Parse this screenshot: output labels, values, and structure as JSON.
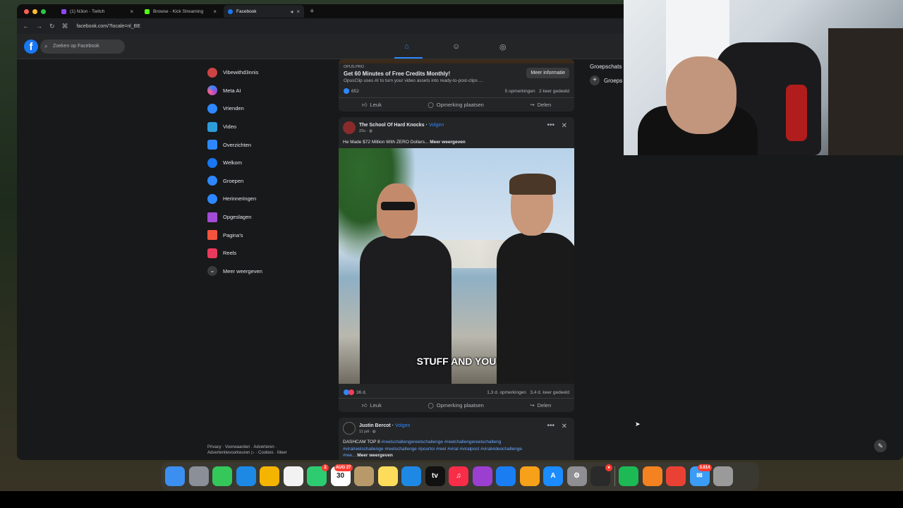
{
  "browser": {
    "tabs": [
      {
        "label": "(1) N3on - Twitch",
        "color": "#9146ff"
      },
      {
        "label": "Browse - Kick Streaming",
        "color": "#53fc18"
      },
      {
        "label": "Facebook",
        "color": "#1877f2"
      }
    ],
    "url": "facebook.com/?locale=nl_BE"
  },
  "facebook": {
    "logo": "f",
    "search_placeholder": "Zoeken op Facebook",
    "sidebar": [
      {
        "label": "Vibewithd3nnis",
        "icon": "avatar",
        "color": "#c44"
      },
      {
        "label": "Meta AI",
        "icon": "meta-ai-icon",
        "color": "#6a5cff"
      },
      {
        "label": "Vrienden",
        "icon": "friends-icon",
        "color": "#2d88ff"
      },
      {
        "label": "Video",
        "icon": "video-icon",
        "color": "#2d9cdb"
      },
      {
        "label": "Overzichten",
        "icon": "feeds-icon",
        "color": "#2d88ff"
      },
      {
        "label": "Welkom",
        "icon": "facebook-icon",
        "color": "#1877f2"
      },
      {
        "label": "Groepen",
        "icon": "groups-icon",
        "color": "#2d88ff"
      },
      {
        "label": "Herinneringen",
        "icon": "memories-icon",
        "color": "#2d88ff"
      },
      {
        "label": "Opgeslagen",
        "icon": "saved-icon",
        "color": "#a34bd6"
      },
      {
        "label": "Pagina's",
        "icon": "pages-icon",
        "color": "#f5533d"
      },
      {
        "label": "Reels",
        "icon": "reels-icon",
        "color": "#e83a5c"
      },
      {
        "label": "Meer weergeven",
        "icon": "chevron-down-icon",
        "color": "#3a3b3c"
      }
    ],
    "footer_line1": "Privacy · Voorwaarden · Adverteren ·",
    "footer_line2": "Advertentievoorkeuren ▷ · Cookies · Meer",
    "ad": {
      "source": "OPUS.PRO",
      "title": "Get 60 Minutes of Free Credits Monthly!",
      "subtitle": "OpusClip uses AI to turn your video assets into ready-to-post-clips ...",
      "button": "Meer informatie",
      "reactions": "652",
      "comments": "5 opmerkingen",
      "shares": "2 keer gedeeld"
    },
    "actions": {
      "like": "Leuk",
      "comment": "Opmerking plaatsen",
      "share": "Delen"
    },
    "post1": {
      "author": "The School Of Hard Knocks",
      "follow": "Volgen",
      "time": "22u · ◍",
      "text": "He Made $72 Million With ZERO Dollars...",
      "more": "Meer weergeven",
      "caption": "STUFF AND YOU",
      "reactions": "36 d.",
      "comments": "1,3 d. opmerkingen",
      "shares": "3,4 d. keer gedeeld"
    },
    "post2": {
      "author": "Justin Bercot",
      "follow": "Volgen",
      "time": "11 juli · ◍",
      "line1_plain": "DASHCAM TOP 8 ",
      "line1_tags": "#reelschallengereelschallenge #reelchallengereelschalleng",
      "line2_tags": "#viralreelschallenge #reelschallenge #pourtoi #reel #viral #viralpost #viralvideochallenge",
      "line3_tags": "#ree...",
      "more": "Meer weergeven"
    },
    "right_heading": "Groepschats",
    "right_item": "Groeps"
  },
  "dock": {
    "apps": [
      {
        "name": "finder-icon",
        "color": "#3b8ff0",
        "glyph": ""
      },
      {
        "name": "launchpad-icon",
        "color": "#8a8f98",
        "glyph": ""
      },
      {
        "name": "messages-icon",
        "color": "#34c759",
        "glyph": ""
      },
      {
        "name": "safari-icon",
        "color": "#1e88e5",
        "glyph": ""
      },
      {
        "name": "photos-icon",
        "color": "#f4b400",
        "glyph": ""
      },
      {
        "name": "reminders-icon",
        "color": "#f2f2f2",
        "glyph": ""
      },
      {
        "name": "facetime-icon",
        "color": "#2ecc71",
        "glyph": "",
        "badge": "2"
      },
      {
        "name": "calendar-icon",
        "color": "#ffffff",
        "glyph": "30",
        "badge": "AUG 27"
      },
      {
        "name": "folder-icon",
        "color": "#b89a6a",
        "glyph": ""
      },
      {
        "name": "notes-icon",
        "color": "#fddc5c",
        "glyph": ""
      },
      {
        "name": "freeform-icon",
        "color": "#1e88e5",
        "glyph": ""
      },
      {
        "name": "appletv-icon",
        "color": "#111111",
        "glyph": "tv"
      },
      {
        "name": "music-icon",
        "color": "#fa2d48",
        "glyph": "♫"
      },
      {
        "name": "podcasts-icon",
        "color": "#9b3fd1",
        "glyph": ""
      },
      {
        "name": "keynote-icon",
        "color": "#1a7ef2",
        "glyph": ""
      },
      {
        "name": "pages-icon",
        "color": "#f7a01a",
        "glyph": ""
      },
      {
        "name": "appstore-icon",
        "color": "#1a8cff",
        "glyph": "A"
      },
      {
        "name": "settings-icon",
        "color": "#8e8e93",
        "glyph": "⚙"
      },
      {
        "name": "activity-monitor-icon",
        "color": "#2a2a2a",
        "glyph": "",
        "badge": "●"
      },
      {
        "name": "spotify-icon",
        "color": "#1db954",
        "glyph": ""
      },
      {
        "name": "vlc-icon",
        "color": "#f58220",
        "glyph": ""
      },
      {
        "name": "chrome-icon",
        "color": "#e94235",
        "glyph": ""
      },
      {
        "name": "mail-icon",
        "color": "#3a9cf5",
        "glyph": "✉",
        "badge": "3.814"
      },
      {
        "name": "trash-icon",
        "color": "#9a9a9a",
        "glyph": ""
      }
    ]
  }
}
